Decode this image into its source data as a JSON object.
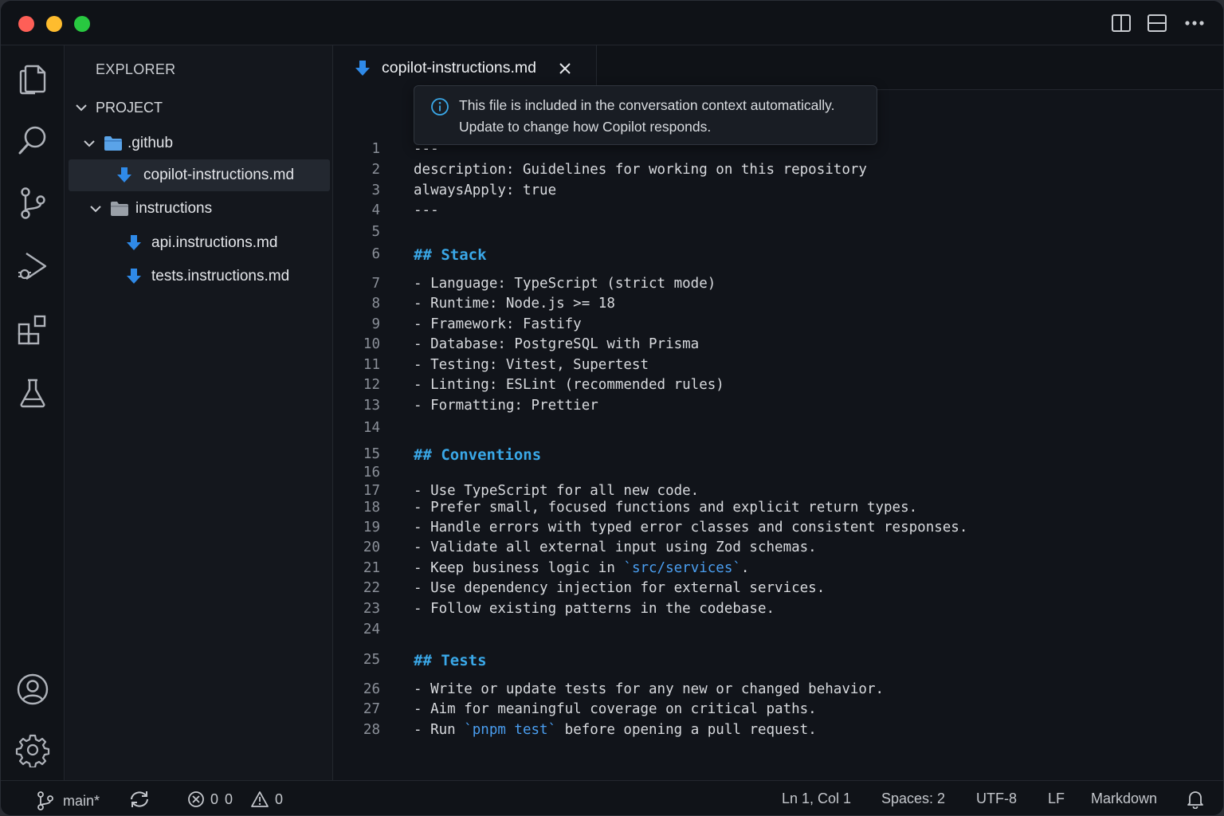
{
  "colors": {
    "accent": "#3aa8e8",
    "file_icon_blue": "#2f8ae8",
    "folder_blue": "#5aa3e8",
    "background": "#11141a"
  },
  "activity_bar": {
    "icons": [
      "files-icon",
      "search-icon",
      "source-control-icon",
      "run-debug-icon",
      "extensions-icon",
      "testing-icon",
      "account-icon",
      "settings-gear-icon"
    ]
  },
  "sidebar": {
    "title": "EXPLORER",
    "project_label": "PROJECT",
    "tree": [
      {
        "label": ".github",
        "type": "folder-open"
      },
      {
        "label": "copilot-instructions.md",
        "type": "file"
      },
      {
        "label": "instructions",
        "type": "folder-open"
      },
      {
        "label": "api.instructions.md",
        "type": "file"
      },
      {
        "label": "tests.instructions.md",
        "type": "file"
      }
    ]
  },
  "editor": {
    "tab_label": "copilot-instructions.md",
    "tooltip": {
      "line1": "This file is included in the conversation context automatically.",
      "line2": "Update to change how Copilot responds."
    },
    "lines": [
      {
        "n": "1",
        "text": "---"
      },
      {
        "n": "2",
        "text": "description: Guidelines for working on this repository"
      },
      {
        "n": "3",
        "text": "alwaysApply: true"
      },
      {
        "n": "4",
        "text": "---"
      },
      {
        "n": "5",
        "text": ""
      },
      {
        "n": "6",
        "text": "## Stack"
      },
      {
        "n": "7",
        "text": "- Language: TypeScript (strict mode)"
      },
      {
        "n": "8",
        "text": "- Runtime: Node.js >= 18"
      },
      {
        "n": "9",
        "text": "- Framework: Fastify"
      },
      {
        "n": "10",
        "text": "- Database: PostgreSQL with Prisma"
      },
      {
        "n": "11",
        "text": "- Testing: Vitest, Supertest"
      },
      {
        "n": "12",
        "text": "- Linting: ESLint (recommended rules)"
      },
      {
        "n": "13",
        "text": "- Formatting: Prettier"
      },
      {
        "n": "14",
        "text": ""
      },
      {
        "n": "15",
        "text": "## Conventions"
      },
      {
        "n": "16",
        "text": ""
      },
      {
        "n": "17",
        "text": "- Use TypeScript for all new code."
      },
      {
        "n": "18",
        "text": "- Prefer small, focused functions and explicit return types."
      },
      {
        "n": "19",
        "text": "- Handle errors with typed error classes and consistent responses."
      },
      {
        "n": "20",
        "text": "- Validate all external input using Zod schemas."
      },
      {
        "n": "21",
        "pre": "- Keep business logic in ",
        "code": "`src/services`",
        "post": "."
      },
      {
        "n": "22",
        "text": "- Use dependency injection for external services."
      },
      {
        "n": "23",
        "text": "- Follow existing patterns in the codebase."
      },
      {
        "n": "24",
        "text": ""
      },
      {
        "n": "25",
        "text": "## Tests"
      },
      {
        "n": "26",
        "text": "- Write or update tests for any new or changed behavior."
      },
      {
        "n": "27",
        "text": "- Aim for meaningful coverage on critical paths."
      },
      {
        "n": "28",
        "pre": "- Run ",
        "code": "`pnpm test`",
        "post": " before opening a pull request."
      }
    ]
  },
  "statusbar": {
    "branch": "main*",
    "errors": "0",
    "info": "0",
    "warnings": "0",
    "cursor": "Ln 1, Col 1",
    "spaces": "Spaces: 2",
    "encoding": "UTF-8",
    "eol": "LF",
    "language": "Markdown"
  }
}
